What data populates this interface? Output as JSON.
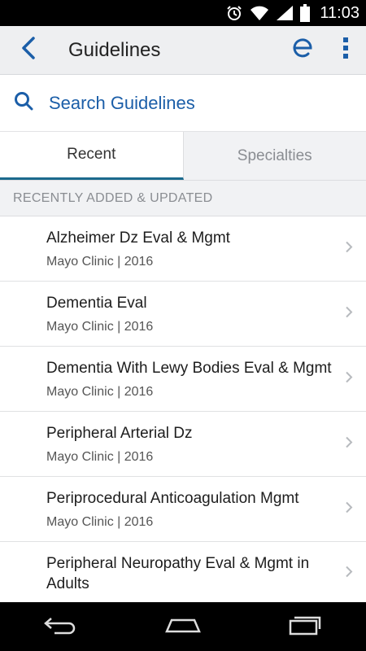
{
  "status_bar": {
    "time": "11:03",
    "icons": [
      "alarm-icon",
      "wifi-icon",
      "signal-icon",
      "battery-icon"
    ]
  },
  "app_bar": {
    "title": "Guidelines",
    "back_icon": "chevron-left-icon",
    "logo_icon": "epocrates-e-icon",
    "menu_icon": "more-vertical-icon"
  },
  "search": {
    "label": "Search Guidelines",
    "icon": "search-icon"
  },
  "tabs": [
    {
      "label": "Recent",
      "active": true
    },
    {
      "label": "Specialties",
      "active": false
    }
  ],
  "section": {
    "title": "RECENTLY ADDED & UPDATED"
  },
  "items": [
    {
      "title": "Alzheimer Dz Eval & Mgmt",
      "subtitle": "Mayo Clinic | 2016"
    },
    {
      "title": "Dementia Eval",
      "subtitle": "Mayo Clinic | 2016"
    },
    {
      "title": "Dementia With Lewy Bodies Eval & Mgmt",
      "subtitle": "Mayo Clinic | 2016"
    },
    {
      "title": "Peripheral Arterial Dz",
      "subtitle": "Mayo Clinic | 2016"
    },
    {
      "title": "Periprocedural Anticoagulation Mgmt",
      "subtitle": "Mayo Clinic | 2016"
    },
    {
      "title": "Peripheral Neuropathy Eval & Mgmt in Adults",
      "subtitle": ""
    }
  ],
  "nav_bar": {
    "icons": [
      "back-nav-icon",
      "home-nav-icon",
      "recents-nav-icon"
    ]
  },
  "colors": {
    "accent": "#1b5ea8",
    "tab_indicator": "#1b6a8d",
    "header_bg": "#eeeff1"
  }
}
